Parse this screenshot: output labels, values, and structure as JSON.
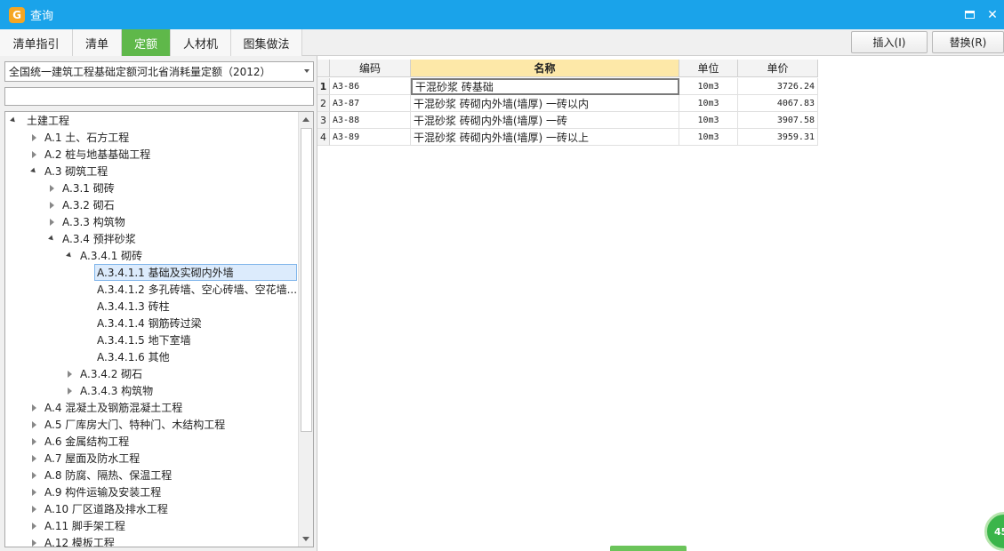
{
  "window": {
    "title": "查询",
    "app_icon": "app-logo-icon"
  },
  "tabs": [
    {
      "label": "清单指引"
    },
    {
      "label": "清单"
    },
    {
      "label": "定额"
    },
    {
      "label": "人材机"
    },
    {
      "label": "图集做法"
    }
  ],
  "actions": {
    "insert_label": "插入(I)",
    "replace_label": "替换(R)"
  },
  "left": {
    "library_selected": "全国统一建筑工程基础定额河北省消耗量定额（2012）",
    "search_value": "",
    "tree": [
      {
        "label": "土建工程"
      },
      {
        "label": "A.1 土、石方工程"
      },
      {
        "label": "A.2 桩与地基基础工程"
      },
      {
        "label": "A.3 砌筑工程"
      },
      {
        "label": "A.3.1 砌砖"
      },
      {
        "label": "A.3.2 砌石"
      },
      {
        "label": "A.3.3 构筑物"
      },
      {
        "label": "A.3.4 预拌砂浆"
      },
      {
        "label": "A.3.4.1 砌砖"
      },
      {
        "label": "A.3.4.1.1 基础及实砌内外墙"
      },
      {
        "label": "A.3.4.1.2 多孔砖墙、空心砖墙、空花墙..."
      },
      {
        "label": "A.3.4.1.3 砖柱"
      },
      {
        "label": "A.3.4.1.4 钢筋砖过梁"
      },
      {
        "label": "A.3.4.1.5 地下室墙"
      },
      {
        "label": "A.3.4.1.6 其他"
      },
      {
        "label": "A.3.4.2 砌石"
      },
      {
        "label": "A.3.4.3 构筑物"
      },
      {
        "label": "A.4 混凝土及钢筋混凝土工程"
      },
      {
        "label": "A.5 厂库房大门、特种门、木结构工程"
      },
      {
        "label": "A.6 金属结构工程"
      },
      {
        "label": "A.7 屋面及防水工程"
      },
      {
        "label": "A.8 防腐、隔热、保温工程"
      },
      {
        "label": "A.9 构件运输及安装工程"
      },
      {
        "label": "A.10 厂区道路及排水工程"
      },
      {
        "label": "A.11 脚手架工程"
      },
      {
        "label": "A.12 模板工程"
      }
    ]
  },
  "table": {
    "headers": [
      "编码",
      "名称",
      "单位",
      "单价"
    ],
    "rows": [
      {
        "idx": "1",
        "code": "A3-86",
        "name": "干混砂浆 砖基础",
        "unit": "10m3",
        "price": "3726.24"
      },
      {
        "idx": "2",
        "code": "A3-87",
        "name": "干混砂浆 砖砌内外墙(墙厚) 一砖以内",
        "unit": "10m3",
        "price": "4067.83"
      },
      {
        "idx": "3",
        "code": "A3-88",
        "name": "干混砂浆 砖砌内外墙(墙厚) 一砖",
        "unit": "10m3",
        "price": "3907.58"
      },
      {
        "idx": "4",
        "code": "A3-89",
        "name": "干混砂浆 砖砌内外墙(墙厚) 一砖以上",
        "unit": "10m3",
        "price": "3959.31"
      }
    ]
  },
  "badge_text": "45",
  "colors": {
    "titlebar": "#1aa3ea",
    "active_tab": "#5fb84a",
    "header_selected": "#fde8a8"
  }
}
